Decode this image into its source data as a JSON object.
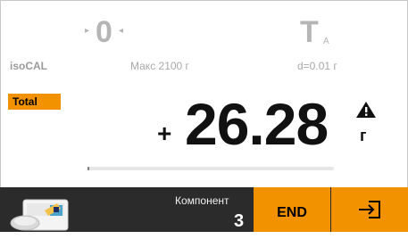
{
  "indicators": {
    "zero_symbol": "0",
    "zero_arrow_left": "▸",
    "zero_arrow_right": "◂",
    "tare_symbol": "T",
    "tare_sub": "A"
  },
  "info": {
    "app_name": "isoCAL",
    "capacity": "Макс 2100 г",
    "resolution": "d=0.01 г"
  },
  "badge": {
    "total": "Total"
  },
  "reading": {
    "sign": "+",
    "value": "26.28",
    "unit": "г",
    "warning_icon": "warning-triangle-icon"
  },
  "progress": {
    "fraction": 0.005
  },
  "bottom": {
    "component_label": "Компонент",
    "component_value": "3",
    "end_label": "END",
    "exit_icon": "exit-icon",
    "thumb_icon": "weighing-pan-icon"
  },
  "colors": {
    "accent": "#f39200",
    "bar_bg": "#2b2b2b"
  }
}
